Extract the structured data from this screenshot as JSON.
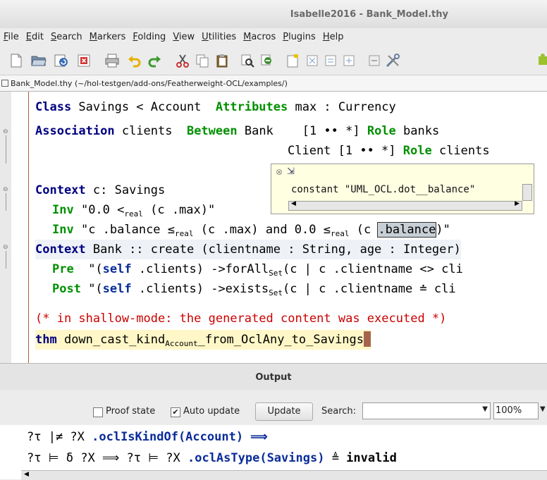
{
  "window": {
    "title": "Isabelle2016 - Bank_Model.thy"
  },
  "menu": [
    "File",
    "Edit",
    "Search",
    "Markers",
    "Folding",
    "View",
    "Utilities",
    "Macros",
    "Plugins",
    "Help"
  ],
  "toolbar_icons": [
    "new-file-icon",
    "open-folder-icon",
    "reload-icon",
    "close-icon",
    "print-icon",
    "undo-icon",
    "redo-icon",
    "cut-icon",
    "copy-icon",
    "paste-icon",
    "find-icon",
    "find-replace-icon",
    "new-buffer-icon",
    "expand-icon",
    "collapse-icon",
    "fold-icon",
    "settings-icon",
    "tools-icon",
    "plugin-icon"
  ],
  "file_tab": {
    "label": "Bank_Model.thy (~/hol-testgen/add-ons/Featherweight-OCL/examples/)"
  },
  "editor": {
    "l1": {
      "a": "Class",
      "b": " Savings < Account  ",
      "c": "Attributes",
      "d": " max : Currency"
    },
    "l2": {
      "a": "Association",
      "b": " clients  ",
      "c": "Between",
      "d": " Bank    [1 •• *] ",
      "e": "Role",
      "f": " banks"
    },
    "l3": {
      "a": "Client [1 •• *] ",
      "b": "Role",
      "c": " clients"
    },
    "l4": {
      "a": "Context",
      "b": " c: Savings"
    },
    "l5": {
      "a": "Inv",
      "b": " \"0.0 <",
      "c": "real",
      "d": " (c .max)\""
    },
    "l6": {
      "a": "Inv",
      "b": " \"c .balance ≤",
      "c": "real",
      "d": " (c .max) and 0.0 ≤",
      "e": "real",
      "f": " (c ",
      "g": ".balance",
      "h": ")\""
    },
    "l7": {
      "a": "Context",
      "b": " Bank :: create (clientname : String, age : Integer)"
    },
    "l8": {
      "a": "Pre",
      "b": "  \"(",
      "c": "self",
      "d": " .clients) ->forAll",
      "e": "Set",
      "f": "(c | c .clientname <> cli"
    },
    "l9": {
      "a": "Post",
      "b": " \"(",
      "c": "self",
      "d": " .clients) ->exists",
      "e": "Set",
      "f": "(c | c .clientname ≐ cli"
    },
    "l10": "(* in shallow-mode: the generated content was executed *)",
    "l11": {
      "a": "thm",
      "b": " down_cast_kind",
      "c": "Account",
      "d": "_from_OclAny_to_Savings"
    }
  },
  "popup": {
    "text": "constant \"UML_OCL.dot__balance\""
  },
  "output": {
    "title": "Output",
    "proof_state_label": "Proof state",
    "proof_state_checked": false,
    "auto_update_label": "Auto update",
    "auto_update_checked": true,
    "update_button": "Update",
    "search_label": "Search:",
    "search_value": "",
    "zoom": "100%",
    "line1": {
      "a": "?τ |≠ ?X ",
      "b": ".oclIsKindOf(Account) ⟹"
    },
    "line2": {
      "a": "?τ ⊨ δ ?X ⟹ ?τ ⊨ ?X ",
      "b": ".oclAsType(Savings)",
      "c": " ≜ ",
      "d": "invalid"
    }
  }
}
